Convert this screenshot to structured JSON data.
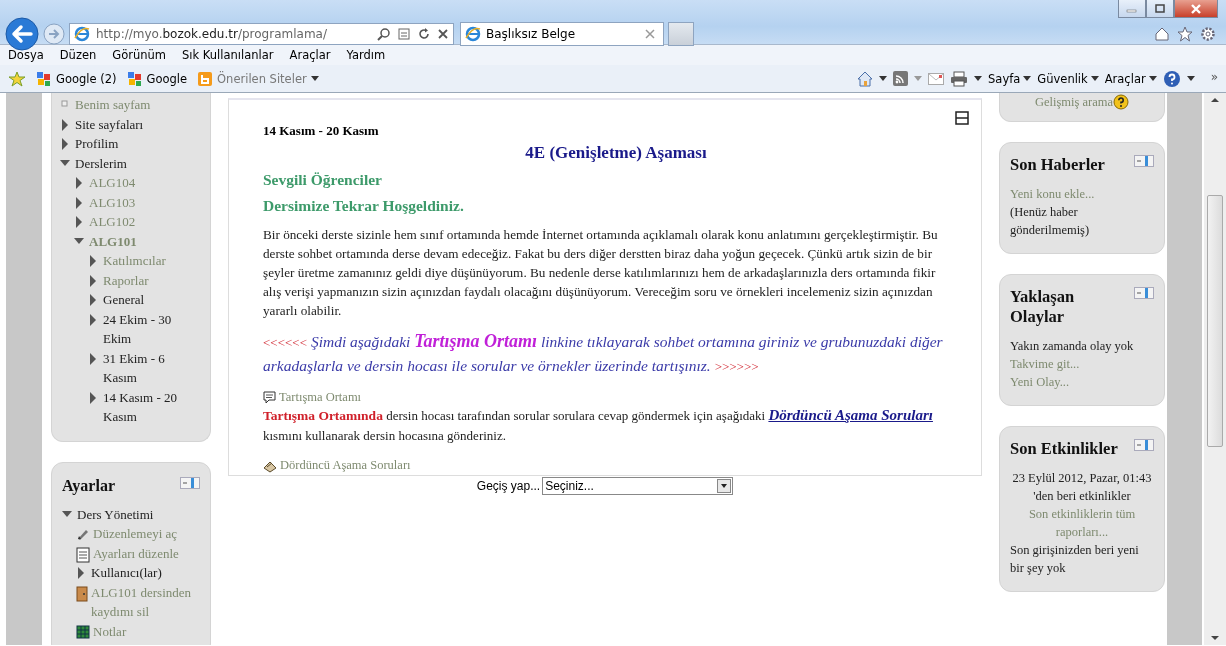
{
  "browser": {
    "address": "http://myo.**bozok.edu.tr**/programlama/",
    "tab": "Başlıksız Belge",
    "menu": [
      "Dosya",
      "Düzen",
      "Görünüm",
      "Sık Kullanılanlar",
      "Araçlar",
      "Yardım"
    ],
    "favorites": [
      {
        "label": "Google (2)",
        "kind": "google"
      },
      {
        "label": "Google",
        "kind": "google"
      },
      {
        "label": "Önerilen Siteler",
        "kind": "suggested"
      }
    ],
    "command_bar": [
      "Sayfa",
      "Güvenlik",
      "Araçlar"
    ],
    "overflow": "»"
  },
  "nav": {
    "items": [
      {
        "label": "Benim sayfam",
        "kind": "link"
      },
      {
        "label": "Site sayfaları",
        "kind": "plain",
        "expanded": false
      },
      {
        "label": "Profilim",
        "kind": "plain",
        "expanded": false
      },
      {
        "label": "Derslerim",
        "kind": "plain",
        "expanded": true,
        "children": [
          {
            "label": "ALG104",
            "kind": "link",
            "expanded": false
          },
          {
            "label": "ALG103",
            "kind": "link",
            "expanded": false
          },
          {
            "label": "ALG102",
            "kind": "link",
            "expanded": false
          },
          {
            "label": "ALG101",
            "kind": "current",
            "expanded": true,
            "children": [
              {
                "label": "Katılımcılar",
                "kind": "link",
                "expanded": false
              },
              {
                "label": "Raporlar",
                "kind": "link",
                "expanded": false
              },
              {
                "label": "General",
                "kind": "plain",
                "expanded": false
              },
              {
                "label": "24 Ekim - 30 Ekim",
                "kind": "plain",
                "expanded": false
              },
              {
                "label": "31 Ekim - 6 Kasım",
                "kind": "plain",
                "expanded": false
              },
              {
                "label": "14 Kasım - 20 Kasım",
                "kind": "plain",
                "expanded": false
              }
            ]
          }
        ]
      }
    ]
  },
  "settings": {
    "title": "Ayarlar",
    "items": [
      {
        "label": "Ders Yönetimi",
        "kind": "plain",
        "expanded": true,
        "children": [
          {
            "label": "Düzenlemeyi aç",
            "kind": "edit"
          },
          {
            "label": "Ayarları düzenle",
            "kind": "settings"
          },
          {
            "label": "Kullanıcı(lar)",
            "kind": "plain",
            "expanded": false
          },
          {
            "label": "ALG101 dersinden kaydımı sil",
            "kind": "unenrol"
          },
          {
            "label": "Notlar",
            "kind": "grades"
          }
        ]
      }
    ]
  },
  "section": {
    "title": "14 Kasım - 20 Kasım",
    "content": [
      {
        "kind": "heading",
        "text": "4E (Genişletme) Aşaması"
      },
      {
        "kind": "subheading",
        "text": "Sevgili Öğrenciler"
      },
      {
        "kind": "subheading",
        "text": "Dersimize Tekrar Hoşgeldiniz."
      },
      {
        "kind": "paragraph",
        "text": "Bir önceki derste sizinle hem sınıf ortamında hemde İnternet ortamında açıklamalı olarak konu anlatımını gerçekleştirmiştir. Bu derste sohbet ortamında derse devam edeceğiz. Fakat bu ders diğer derstten biraz daha yoğun geçecek. Çünkü artık sizin de bir şeyler üretme zamanınız geldi diye düşünüyorum. Bu nedenle derse katılımlarınızı hem de arkadaşlarınızla ders ortamında fikir alış verişi yapmanızın sizin açınızdan faydalı olacağını düşünüyorum. Vereceğim soru ve örnekleri incelemeniz sizin açınızdan yararlı olabilir."
      },
      {
        "kind": "callout",
        "parts": [
          {
            "kind": "arrows",
            "text": "<<<<<<"
          },
          {
            "kind": "italic",
            "text": " Şimdi aşağıdaki "
          },
          {
            "kind": "emphasis",
            "text": "Tartışma Ortamı"
          },
          {
            "kind": "italic",
            "text": " linkine tıklayarak sohbet ortamına giriniz ve grubunuzdaki diğer arkadaşlarla ve dersin hocası ile sorular ve örnekler üzerinde tartışınız. "
          },
          {
            "kind": "arrows",
            "text": ">>>>>>"
          }
        ]
      },
      {
        "kind": "forum-activity",
        "text": "Tartışma Ortamı"
      },
      {
        "kind": "instruction",
        "parts": [
          {
            "kind": "alert",
            "text": "Tartışma Ortamında"
          },
          {
            "kind": "plain",
            "text": " dersin hocası tarafından sorular sorulara cevap göndermek için aşağıdaki "
          },
          {
            "kind": "link",
            "text": "Dördüncü Aşama Soruları"
          },
          {
            "kind": "plain",
            "text": " kısmını kullanarak dersin hocasına gönderiniz."
          }
        ]
      },
      {
        "kind": "quiz-activity",
        "text": "Dördüncü Aşama Soruları"
      }
    ]
  },
  "jump": {
    "label": "Geçiş yap...",
    "value": "Seçiniz..."
  },
  "blocks": [
    {
      "lines": [
        {
          "kind": "help-link",
          "text": "Gelişmiş arama"
        }
      ]
    },
    {
      "title": "Son Haberler",
      "lines": [
        {
          "kind": "link",
          "text": "Yeni konu ekle..."
        },
        {
          "kind": "text",
          "text": "(Henüz haber gönderilmemiş)"
        }
      ]
    },
    {
      "title": "Yaklaşan Olaylar",
      "lines": [
        {
          "kind": "text",
          "text": "Yakın zamanda olay yok"
        },
        {
          "kind": "link",
          "text": "Takvime git..."
        },
        {
          "kind": "link",
          "text": "Yeni Olay..."
        }
      ]
    },
    {
      "title": "Son Etkinlikler",
      "lines": [
        {
          "kind": "center-text",
          "text": "23 Eylül 2012, Pazar, 01:43 'den beri etkinlikler"
        },
        {
          "kind": "center-link",
          "text": "Son etkinliklerin tüm raporları..."
        },
        {
          "kind": "text",
          "text": "Son girişinizden beri yeni bir şey yok"
        }
      ]
    }
  ]
}
